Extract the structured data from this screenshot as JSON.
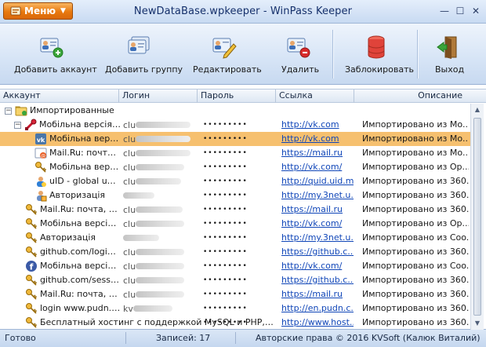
{
  "window": {
    "title": "NewDataBase.wpkeeper - WinPass Keeper",
    "menu_label": "Меню",
    "controls": {
      "minimize": "—",
      "maximize": "☐",
      "close": "✕"
    }
  },
  "toolbar": {
    "add_account": "Добавить аккаунт",
    "add_group": "Добавить группу",
    "edit": "Редактировать",
    "delete": "Удалить",
    "lock": "Заблокировать",
    "exit": "Выход"
  },
  "columns": {
    "account": "Аккаунт",
    "login": "Логин",
    "password": "Пароль",
    "link": "Ссылка",
    "description": "Описание"
  },
  "rows": [
    {
      "level": 0,
      "expander": "−",
      "icon": "folder-icon",
      "account": "Импортированные",
      "login": "",
      "password": "",
      "link": "",
      "description": ""
    },
    {
      "level": 1,
      "expander": "−",
      "icon": "key-red-icon",
      "account": "Мобільна версія ...",
      "login": "clu",
      "blur": 70,
      "password": "•••••••••",
      "link": "http://vk.com",
      "description": "Импортировано из Мо..."
    },
    {
      "level": 2,
      "icon": "vk-icon",
      "account": "Мобільна версі...",
      "login": "clu",
      "blur": 70,
      "password": "•••••••••",
      "link": "http://vk.com",
      "description": "Импортировано из Мо...",
      "selected": true
    },
    {
      "level": 2,
      "icon": "mailru-icon",
      "account": "Mail.Ru: почта, ...",
      "login": "clu",
      "blur": 70,
      "password": "•••••••••",
      "link": "https://mail.ru",
      "description": "Импортировано из Мо..."
    },
    {
      "level": 2,
      "icon": "key-icon",
      "account": "Мобільна версі...",
      "login": "clu",
      "blur": 62,
      "password": "•••••••••",
      "link": "http://vk.com/",
      "description": "Импортировано из Op..."
    },
    {
      "level": 2,
      "icon": "uid-icon",
      "account": "uID - global uCo...",
      "login": "clu",
      "blur": 58,
      "password": "•••••••••",
      "link": "http://quid.uid.m...",
      "description": "Импортировано из 360..."
    },
    {
      "level": 2,
      "icon": "user-icon",
      "account": "Авторизація",
      "login": "",
      "blur": 40,
      "password": "•••••••••",
      "link": "http://my.3net.u...",
      "description": "Импортировано из 360..."
    },
    {
      "level": 1,
      "icon": "key-icon",
      "account": "Mail.Ru: почта, по...",
      "login": "clu",
      "blur": 60,
      "password": "•••••••••",
      "link": "https://mail.ru",
      "description": "Импортировано из 360..."
    },
    {
      "level": 1,
      "icon": "key-icon",
      "account": "Мобільна версія ...",
      "login": "clu",
      "blur": 62,
      "password": "•••••••••",
      "link": "http://vk.com/",
      "description": "Импортировано из Op..."
    },
    {
      "level": 1,
      "icon": "key-icon",
      "account": "Авторизація",
      "login": "",
      "blur": 46,
      "password": "•••••••••",
      "link": "http://my.3net.u...",
      "description": "Импортировано из Coo..."
    },
    {
      "level": 1,
      "icon": "key-icon",
      "account": "github.com/login (...",
      "login": "clu",
      "blur": 62,
      "password": "•••••••••",
      "link": "https://github.c...",
      "description": "Импортировано из 360..."
    },
    {
      "level": 1,
      "icon": "facebook-icon",
      "account": "Мобільна версія ...",
      "login": "clu",
      "blur": 62,
      "password": "•••••••••",
      "link": "http://vk.com/",
      "description": "Импортировано из Coo..."
    },
    {
      "level": 1,
      "icon": "key-icon",
      "account": "github.com/sessio...",
      "login": "clu",
      "blur": 62,
      "password": "•••••••••",
      "link": "https://github.c...",
      "description": "Импортировано из 360..."
    },
    {
      "level": 1,
      "icon": "key-icon",
      "account": "Mail.Ru: почта, по...",
      "login": "clu",
      "blur": 62,
      "password": "•••••••••",
      "link": "https://mail.ru",
      "description": "Импортировано из 360..."
    },
    {
      "level": 1,
      "icon": "key-icon",
      "account": "login www.pudn.c...",
      "login": "kv",
      "blur": 50,
      "password": "•••••••••",
      "link": "http://en.pudn.c...",
      "description": "Импортировано из 360..."
    },
    {
      "level": 1,
      "icon": "key-icon",
      "account": "Бесплатный хостинг с поддержкой MySQL и PHP, конст...",
      "login": "",
      "blur": 0,
      "password": "•••••••••",
      "link": "http://www.host...",
      "description": "Импортировано из 360..."
    }
  ],
  "status": {
    "state": "Готово",
    "records": "Записей: 17",
    "copyright": "Авторские права © 2016 KVSoft (Калюк Виталий)"
  }
}
